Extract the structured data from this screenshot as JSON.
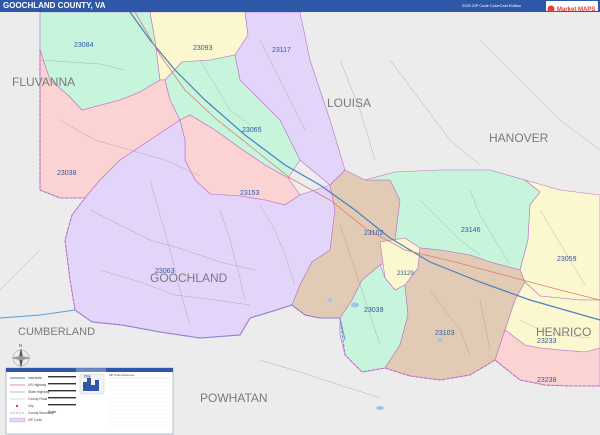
{
  "header": {
    "title": "GOOCHLAND COUNTY, VA",
    "edition": "2020 ZIP Code ColorCast Edition",
    "brand_logo_text": "Market MAPS"
  },
  "map": {
    "counties": [
      "FLUVANNA",
      "LOUISA",
      "HANOVER",
      "GOOCHLAND",
      "CUMBERLAND",
      "POWHATAN",
      "HENRICO"
    ],
    "zip_codes": [
      "23084",
      "23093",
      "23117",
      "23065",
      "23038",
      "23153",
      "23063",
      "23102",
      "23146",
      "23129",
      "23059",
      "23039",
      "23103",
      "23233",
      "23238"
    ],
    "colors": {
      "outside": "#ececec",
      "purple": "#e3d5fa",
      "green": "#c6f5dc",
      "pink": "#fbd3d3",
      "tan": "#e2cbb4",
      "yellow": "#fbf8cf",
      "zip_label": "#2f57a8",
      "county_label": "#7a7a7a",
      "road": "#9a9a9a",
      "highway": "#4a7fc0",
      "river": "#5a9fd8",
      "county_border": "#bd6fc8"
    }
  },
  "legend": {
    "rows": [
      "Interstate",
      "US Highway",
      "State Highway",
      "County Road",
      "City",
      "County Boundary",
      "ZIP Code"
    ],
    "scale_label": "Scale",
    "icon_label": "City",
    "table_header": "ZIP Code Reference"
  },
  "compass": {
    "north_label": "N"
  }
}
